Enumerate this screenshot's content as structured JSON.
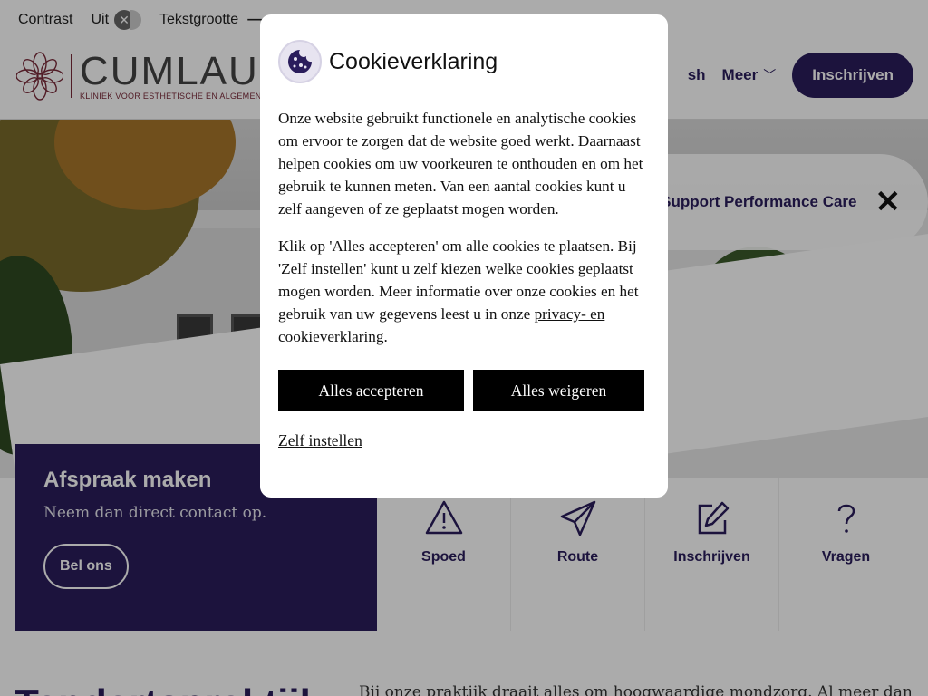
{
  "topbar": {
    "contrast_label": "Contrast",
    "contrast_state": "Uit",
    "textsize_label": "Tekstgrootte",
    "textsize_minus": "—"
  },
  "header": {
    "logo_text": "CUMLAUDE",
    "logo_tagline": "KLINIEK VOOR ESTHETISCHE EN ALGEMENE TANDHEELKUNDE",
    "nav_partial": "sh",
    "nav_more": "Meer",
    "nav_cta": "Inschrijven"
  },
  "hero": {
    "banner_text": "Support Performance Care"
  },
  "appointment": {
    "title": "Afspraak maken",
    "subtitle": "Neem dan direct contact op.",
    "button": "Bel ons"
  },
  "quicklinks": [
    {
      "label": "Spoed",
      "icon": "warning-icon"
    },
    {
      "label": "Route",
      "icon": "paper-plane-icon"
    },
    {
      "label": "Inschrijven",
      "icon": "edit-icon"
    },
    {
      "label": "Vragen",
      "icon": "question-icon"
    }
  ],
  "intro": {
    "heading": "Tandartspraktijk",
    "text": "Bij onze praktijk draait alles om hoogwaardige mondzorg. Al meer dan"
  },
  "cookie_modal": {
    "title": "Cookieverklaring",
    "paragraph1": "Onze website gebruikt functionele en analytische cookies om ervoor te zorgen dat de website goed werkt. Daarnaast helpen cookies om uw voorkeuren te onthouden en om het gebruik te kunnen meten. Van een aantal cookies kunt u zelf aangeven of ze geplaatst mogen worden.",
    "paragraph2_before": "Klik op 'Alles accepteren' om alle cookies te plaatsen. Bij 'Zelf instellen' kunt u zelf kiezen welke cookies geplaatst mogen worden. Meer informatie over onze cookies en het gebruik van uw gegevens leest u in onze ",
    "paragraph2_link": "privacy- en cookieverklaring.",
    "accept_button": "Alles accepteren",
    "reject_button": "Alles weigeren",
    "settings_link": "Zelf instellen"
  },
  "colors": {
    "brand_purple": "#2a1d5c",
    "logo_burgundy": "#7a2a3a",
    "button_black": "#000000"
  }
}
